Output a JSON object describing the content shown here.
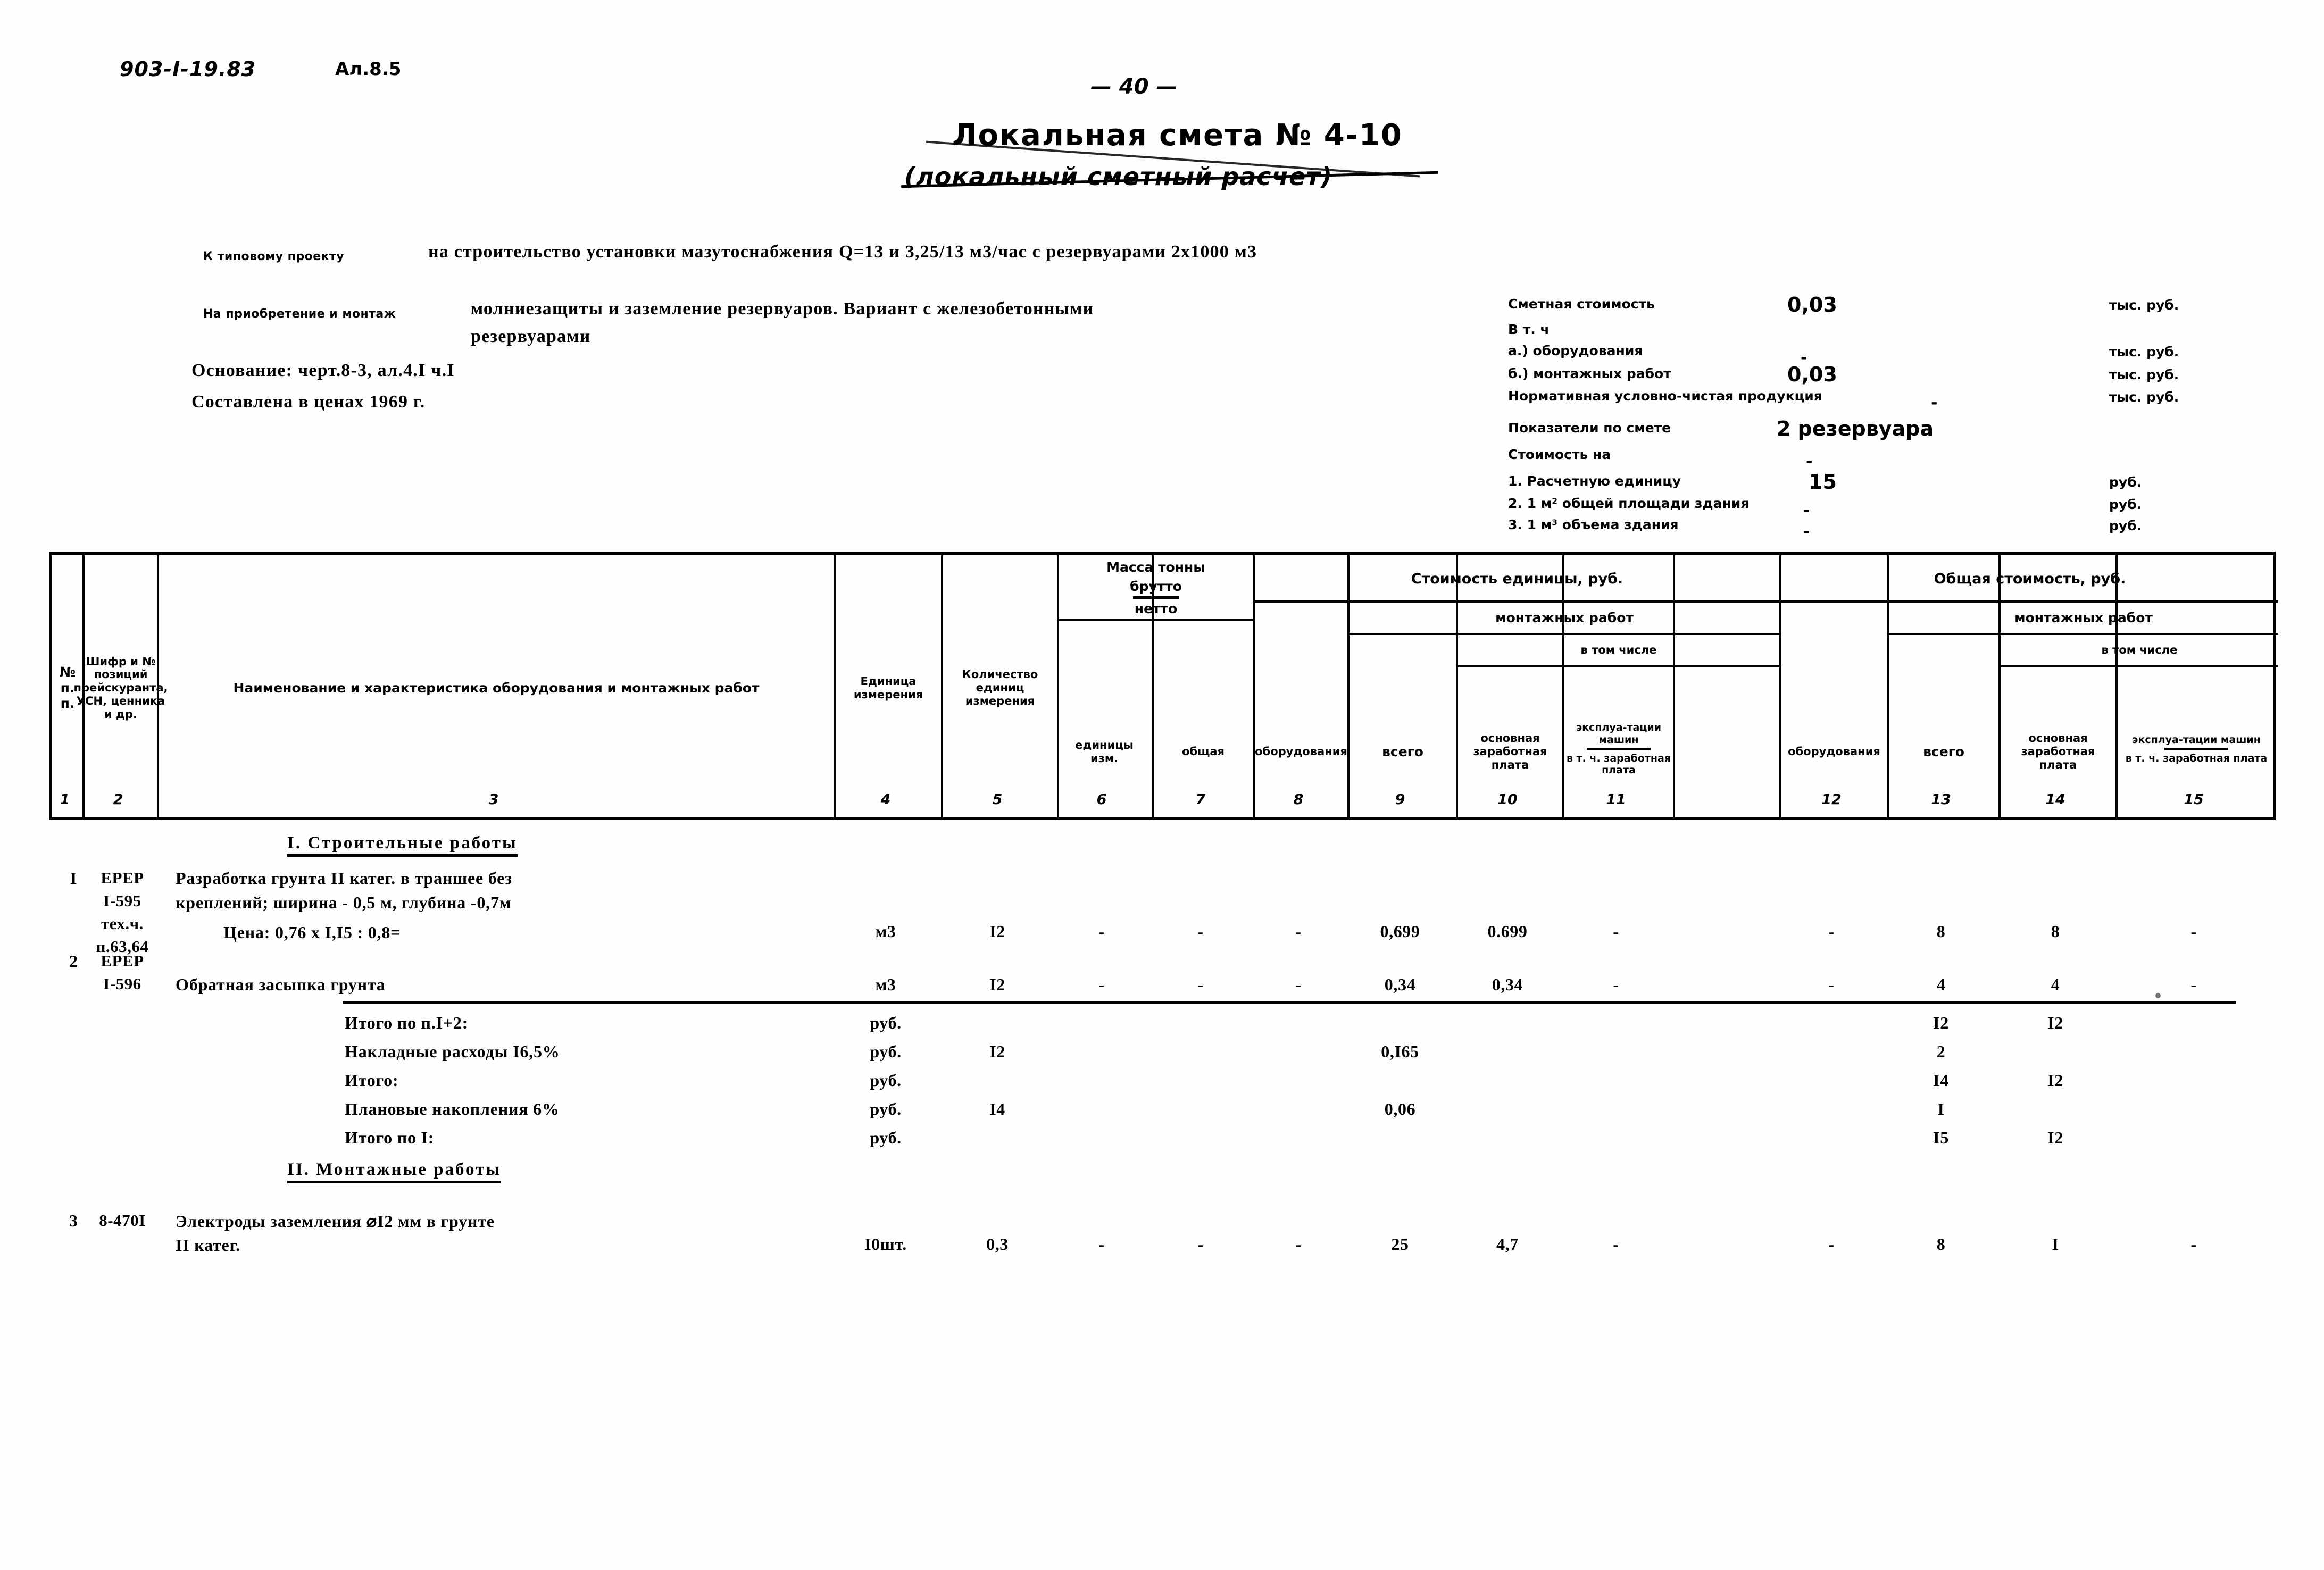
{
  "header": {
    "doc_code": "903-I-19.83",
    "album_code": "Ал.8.5",
    "page_number": "— 40 —"
  },
  "title": {
    "main": "Локальная смета № 4-10",
    "sub": "(локальный сметный расчет)"
  },
  "intro": {
    "label_project": "К типовому проекту",
    "project_text": "на строительство установки мазутоснабжения Q=13 и 3,25/13 м3/час с резервуарами 2х1000 м3",
    "label_purchase": "На приобретение и монтаж",
    "work_line1": "молниезащиты и заземление резервуаров. Вариант с железобетонными",
    "work_line2": "резервуарами",
    "basis": "Основание: черт.8-3, ал.4.I ч.I",
    "prices": "Составлена в ценах 1969 г."
  },
  "summary": {
    "rows": [
      {
        "name": "Сметная стоимость",
        "value": "0,03",
        "unit": "тыс. руб."
      },
      {
        "name": "В т. ч",
        "value": "",
        "unit": ""
      },
      {
        "name": "а.) оборудования",
        "value": "-",
        "unit": "тыс. руб."
      },
      {
        "name": "б.) монтажных работ",
        "value": "0,03",
        "unit": "тыс. руб."
      },
      {
        "name": "Нормативная условно-чистая продукция",
        "value": "-",
        "unit": "тыс. руб."
      },
      {
        "name": "Показатели по смете",
        "value": "2 резервуара",
        "unit": ""
      },
      {
        "name": "Стоимость на",
        "value": "-",
        "unit": ""
      },
      {
        "name": "1. Расчетную единицу",
        "value": "15",
        "unit": "руб."
      },
      {
        "name": "2. 1 м² общей площади здания",
        "value": "-",
        "unit": "руб."
      },
      {
        "name": "3. 1 м³ объема здания",
        "value": "-",
        "unit": "руб."
      }
    ]
  },
  "table": {
    "headers": {
      "c1": "№ п. п.",
      "c2": "Шифр и № позиций прейскуранта, УСН, ценника и др.",
      "c3": "Наименование и характеристика оборудования и монтажных работ",
      "c4": "Единица измерения",
      "c5": "Количество единиц измерения",
      "mass_group": "Масса тонны",
      "mass_brutto": "брутто",
      "mass_netto": "нетто",
      "c6": "единицы изм.",
      "c7": "общая",
      "unit_cost_group": "Стоимость единицы, руб.",
      "unit_mount_group": "монтажных работ",
      "unit_incl": "в том числе",
      "c8": "оборудования",
      "c9": "всего",
      "c10": "основная заработная плата",
      "c11_a": "эксплуа-тации машин",
      "c11_b": "в т. ч. заработная плата",
      "total_cost_group": "Общая стоимость, руб.",
      "total_mount_group": "монтажных работ",
      "total_incl": "в том числе",
      "c12": "оборудования",
      "c13": "всего",
      "c14": "основная заработная плата",
      "c15_a": "эксплуа-тации машин",
      "c15_b": "в т. ч. заработная плата"
    },
    "column_numbers": [
      "1",
      "2",
      "3",
      "4",
      "5",
      "6",
      "7",
      "8",
      "9",
      "10",
      "11",
      "12",
      "13",
      "14",
      "15"
    ],
    "sections": [
      {
        "id": "s1",
        "title": "I. Строительные работы"
      },
      {
        "id": "s2",
        "title": "II. Монтажные работы"
      }
    ],
    "rows": [
      {
        "num": "I",
        "code_lines": [
          "ЕРЕР",
          "I-595",
          "тех.ч.",
          "п.63,64"
        ],
        "desc_lines": [
          "Разработка грунта II катег. в траншее без",
          "креплений; ширина - 0,5 м, глубина -0,7м",
          "Цена: 0,76 х I,I5 : 0,8="
        ],
        "c4": "м3",
        "c5": "I2",
        "c6": "-",
        "c7": "-",
        "c8": "-",
        "c9": "0,699",
        "c10": "0.699",
        "c11": "-",
        "c12": "-",
        "c13": "8",
        "c14": "8",
        "c15": "-"
      },
      {
        "num": "2",
        "code_lines": [
          "ЕРЕР",
          "I-596"
        ],
        "desc_lines": [
          "Обратная засыпка грунта"
        ],
        "c4": "м3",
        "c5": "I2",
        "c6": "-",
        "c7": "-",
        "c8": "-",
        "c9": "0,34",
        "c10": "0,34",
        "c11": "-",
        "c12": "-",
        "c13": "4",
        "c14": "4",
        "c15": "-"
      },
      {
        "num": "",
        "code_lines": [],
        "desc_lines": [
          "Итого по п.I+2:"
        ],
        "c4": "руб.",
        "c5": "",
        "c6": "",
        "c7": "",
        "c8": "",
        "c9": "",
        "c10": "",
        "c11": "",
        "c12": "",
        "c13": "I2",
        "c14": "I2",
        "c15": ""
      },
      {
        "num": "",
        "code_lines": [],
        "desc_lines": [
          "Накладные расходы I6,5%"
        ],
        "c4": "руб.",
        "c5": "I2",
        "c6": "",
        "c7": "",
        "c8": "",
        "c9": "0,I65",
        "c10": "",
        "c11": "",
        "c12": "",
        "c13": "2",
        "c14": "",
        "c15": ""
      },
      {
        "num": "",
        "code_lines": [],
        "desc_lines": [
          "Итого:"
        ],
        "c4": "руб.",
        "c5": "",
        "c6": "",
        "c7": "",
        "c8": "",
        "c9": "",
        "c10": "",
        "c11": "",
        "c12": "",
        "c13": "I4",
        "c14": "I2",
        "c15": ""
      },
      {
        "num": "",
        "code_lines": [],
        "desc_lines": [
          "Плановые накопления 6%"
        ],
        "c4": "руб.",
        "c5": "I4",
        "c6": "",
        "c7": "",
        "c8": "",
        "c9": "0,06",
        "c10": "",
        "c11": "",
        "c12": "",
        "c13": "I",
        "c14": "",
        "c15": ""
      },
      {
        "num": "",
        "code_lines": [],
        "desc_lines": [
          "Итого по I:"
        ],
        "c4": "руб.",
        "c5": "",
        "c6": "",
        "c7": "",
        "c8": "",
        "c9": "",
        "c10": "",
        "c11": "",
        "c12": "",
        "c13": "I5",
        "c14": "I2",
        "c15": ""
      },
      {
        "num": "3",
        "code_lines": [
          "8-470I"
        ],
        "desc_lines": [
          "Электроды заземления ⌀I2 мм в грунте",
          "II катег."
        ],
        "c4": "I0шт.",
        "c5": "0,3",
        "c6": "-",
        "c7": "-",
        "c8": "-",
        "c9": "25",
        "c10": "4,7",
        "c11": "-",
        "c12": "-",
        "c13": "8",
        "c14": "I",
        "c15": "-"
      }
    ]
  }
}
